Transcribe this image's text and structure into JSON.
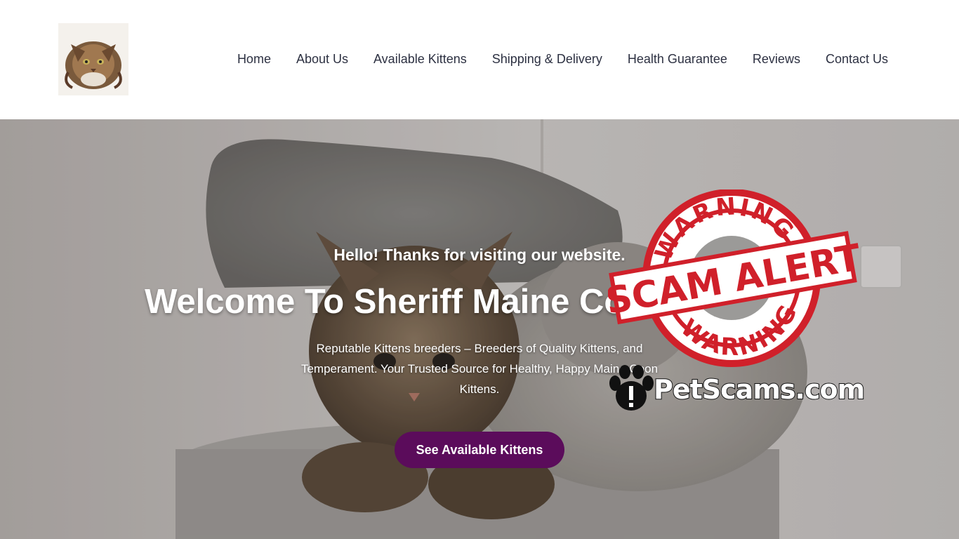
{
  "header": {
    "logo_icon": "maine-coon-cat-logo",
    "nav": [
      {
        "label": "Home"
      },
      {
        "label": "About Us"
      },
      {
        "label": "Available Kittens"
      },
      {
        "label": "Shipping & Delivery"
      },
      {
        "label": "Health Guarantee"
      },
      {
        "label": "Reviews"
      },
      {
        "label": "Contact Us"
      }
    ]
  },
  "hero": {
    "greeting": "Hello! Thanks for visiting our website.",
    "title": "Welcome To Sheriff Maine Coons Cattery",
    "description": "Reputable Kittens breeders – Breeders of Quality Kittens, and Temperament. Your Trusted Source for Healthy, Happy Maine Coon Kittens.",
    "cta_label": "See Available Kittens",
    "cta_color": "#5b0c5b"
  },
  "watermark": {
    "stamp_top": "WARNING",
    "stamp_middle": "SCAM ALERT",
    "stamp_bottom": "WARNING",
    "site": "PetScams.com",
    "stamp_color": "#d0202a"
  }
}
